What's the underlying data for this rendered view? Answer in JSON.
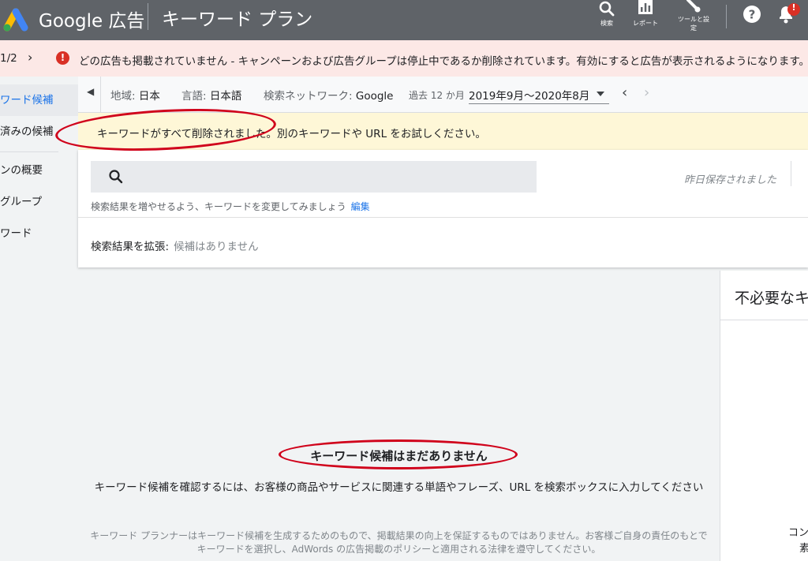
{
  "header": {
    "brand": "Google 広告",
    "app_title": "キーワード プラン",
    "buttons": {
      "search": "検索",
      "reports": "レポート",
      "tools_line1": "ツールと設",
      "tools_line2": "定",
      "notification_count": "!"
    },
    "icons": {
      "search": "search-icon",
      "reports": "bar-chart-icon",
      "tools": "wrench-icon",
      "help": "help-icon",
      "notifications": "bell-icon"
    }
  },
  "alert": {
    "count": "1/2",
    "chevron": "›",
    "icon": "!",
    "message": "どの広告も掲載されていません - キャンペーンおよび広告グループは停止中であるか削除されています。有効にすると広告が表示されるようになります。"
  },
  "sidebar": {
    "items": [
      {
        "label": "ワード候補"
      },
      {
        "label": "済みの候補"
      },
      {
        "label": "ンの概要"
      },
      {
        "label": "グループ"
      },
      {
        "label": "ワード"
      }
    ]
  },
  "filters": {
    "location_key": "地域:",
    "location_value": "日本",
    "language_key": "言語:",
    "language_value": "日本語",
    "network_key": "検索ネットワーク:",
    "network_value": "Google",
    "period_key": "過去 12 か月",
    "period_value": "2019年9月～2020年8月"
  },
  "notice": {
    "message": "キーワードがすべて削除されました。別のキーワードや URL をお試しください。"
  },
  "search": {
    "value": "",
    "placeholder": "",
    "saved_status": "昨日保存されました",
    "hint": "検索結果を増やせるよう、キーワードを変更してみましょう",
    "hint_link": "編集",
    "expand_label": "検索結果を拡張:",
    "expand_value": "候補はありません"
  },
  "empty_state": {
    "title": "キーワード候補はまだありません",
    "description": "キーワード候補を確認するには、お客様の商品やサービスに関連する単語やフレーズ、URL を検索ボックスに入力してください",
    "disclaimer_line1": "キーワード プランナーはキーワード候補を生成するためのもので、掲載結果の向上を保証するものではありません。お客様ご自身の責任のもとで",
    "disclaimer_line2": "キーワードを選択し、AdWords の広告掲載のポリシーと適用される法律を遵守してください。"
  },
  "side_panel": {
    "title": "不必要なキ",
    "text_line1": "コン",
    "text_line2": "素"
  },
  "colors": {
    "header_bg": "#5f6368",
    "alert_bg": "#fce8e6",
    "error_red": "#d93025",
    "notice_bg": "#fef7d7",
    "accent_blue": "#1a73e8",
    "annotation_red": "#d0021b"
  }
}
